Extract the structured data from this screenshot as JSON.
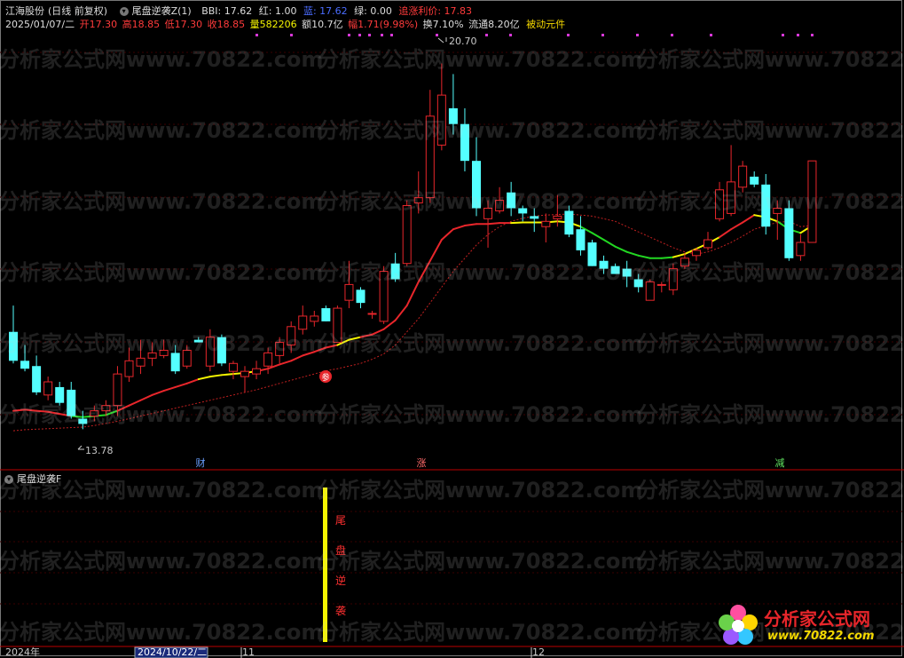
{
  "header": {
    "stock_name": "江海股份",
    "period": "(日线 前复权)",
    "indicator_name": "尾盘逆袭Z(1)",
    "bbi": "BBI: 17.62",
    "red": "红: 1.00",
    "blue": "蓝: 17.62",
    "green": "绿: 0.00",
    "pursue_label": "追涨利价: 17.83"
  },
  "quote": {
    "date": "2025/01/07/二",
    "open": "开17.30",
    "high": "高18.85",
    "low": "低17.30",
    "close": "收18.85",
    "volume": "量582206",
    "amount": "额10.7亿",
    "change": "幅1.71(9.98%)",
    "turnover": "换7.10%",
    "float": "流通8.20亿",
    "element": "被动元件"
  },
  "annotations": {
    "high_price": "20.70",
    "low_price": "13.78",
    "marker_cai": "财",
    "marker_zhang": "涨",
    "marker_jian": "减",
    "marker_can": "参"
  },
  "sub_panel": {
    "title": "尾盘逆袭F",
    "signal_text": [
      "尾",
      "盘",
      "逆",
      "袭"
    ]
  },
  "time_axis": {
    "labels": [
      "2024年",
      "2024/10/22/二",
      "11",
      "12"
    ]
  },
  "watermark": {
    "text": "分析家公式网www.70822.com"
  },
  "logo": {
    "title": "分析家公式网",
    "url": "www.70822.com"
  },
  "colors": {
    "up": "#e8262b",
    "down": "#54ffff",
    "line_up": "#e8262b",
    "line_green": "#22d722",
    "line_yellow": "#f5f500",
    "header_blue": "#4a6cff",
    "header_red": "#ff3b3b",
    "magenta": "#d838d8"
  },
  "chart_data": {
    "type": "candlestick",
    "y_range": [
      13.3,
      21.3
    ],
    "candles": [
      {
        "o": 15.6,
        "h": 16.1,
        "l": 15.0,
        "c": 15.05
      },
      {
        "o": 15.05,
        "h": 15.35,
        "l": 14.85,
        "c": 14.9
      },
      {
        "o": 14.95,
        "h": 15.15,
        "l": 14.4,
        "c": 14.45
      },
      {
        "o": 14.4,
        "h": 14.75,
        "l": 14.3,
        "c": 14.65
      },
      {
        "o": 14.55,
        "h": 14.65,
        "l": 14.2,
        "c": 14.25
      },
      {
        "o": 14.5,
        "h": 14.65,
        "l": 13.95,
        "c": 14.0
      },
      {
        "o": 13.95,
        "h": 14.1,
        "l": 13.75,
        "c": 13.85
      },
      {
        "o": 14.0,
        "h": 14.2,
        "l": 13.9,
        "c": 14.1
      },
      {
        "o": 14.1,
        "h": 14.3,
        "l": 14.0,
        "c": 14.2
      },
      {
        "o": 14.2,
        "h": 14.95,
        "l": 14.0,
        "c": 14.8
      },
      {
        "o": 14.75,
        "h": 15.3,
        "l": 14.65,
        "c": 15.05
      },
      {
        "o": 14.95,
        "h": 15.45,
        "l": 14.8,
        "c": 15.1
      },
      {
        "o": 15.1,
        "h": 15.4,
        "l": 14.95,
        "c": 15.2
      },
      {
        "o": 15.15,
        "h": 15.45,
        "l": 15.1,
        "c": 15.25
      },
      {
        "o": 15.2,
        "h": 15.35,
        "l": 14.8,
        "c": 14.85
      },
      {
        "o": 14.95,
        "h": 15.35,
        "l": 14.9,
        "c": 15.25
      },
      {
        "o": 15.45,
        "h": 15.5,
        "l": 15.4,
        "c": 15.4
      },
      {
        "o": 14.95,
        "h": 15.65,
        "l": 14.85,
        "c": 15.5
      },
      {
        "o": 15.5,
        "h": 15.55,
        "l": 14.95,
        "c": 15.0
      },
      {
        "o": 14.85,
        "h": 15.05,
        "l": 14.7,
        "c": 15.0
      },
      {
        "o": 14.75,
        "h": 14.95,
        "l": 14.45,
        "c": 14.85
      },
      {
        "o": 14.8,
        "h": 15.05,
        "l": 14.7,
        "c": 14.9
      },
      {
        "o": 14.95,
        "h": 15.3,
        "l": 14.8,
        "c": 15.2
      },
      {
        "o": 15.15,
        "h": 15.5,
        "l": 15.0,
        "c": 15.4
      },
      {
        "o": 15.35,
        "h": 15.8,
        "l": 15.2,
        "c": 15.7
      },
      {
        "o": 15.65,
        "h": 16.1,
        "l": 15.55,
        "c": 15.9
      },
      {
        "o": 15.8,
        "h": 16.0,
        "l": 15.7,
        "c": 15.9
      },
      {
        "o": 16.05,
        "h": 16.1,
        "l": 15.8,
        "c": 15.8
      },
      {
        "o": 15.4,
        "h": 16.1,
        "l": 15.4,
        "c": 16.05
      },
      {
        "o": 16.2,
        "h": 16.95,
        "l": 16.05,
        "c": 16.5
      },
      {
        "o": 16.4,
        "h": 16.45,
        "l": 16.05,
        "c": 16.15
      },
      {
        "o": 15.95,
        "h": 16.0,
        "l": 15.85,
        "c": 15.95
      },
      {
        "o": 15.8,
        "h": 16.85,
        "l": 15.75,
        "c": 16.75
      },
      {
        "o": 16.9,
        "h": 17.1,
        "l": 16.55,
        "c": 16.6
      },
      {
        "o": 16.9,
        "h": 18.1,
        "l": 16.85,
        "c": 18.0
      },
      {
        "o": 18.05,
        "h": 18.65,
        "l": 17.85,
        "c": 18.15
      },
      {
        "o": 18.15,
        "h": 20.2,
        "l": 18.05,
        "c": 19.7
      },
      {
        "o": 19.15,
        "h": 20.7,
        "l": 19.05,
        "c": 20.1
      },
      {
        "o": 19.85,
        "h": 20.5,
        "l": 19.35,
        "c": 19.55
      },
      {
        "o": 19.55,
        "h": 19.85,
        "l": 18.65,
        "c": 18.85
      },
      {
        "o": 18.85,
        "h": 19.3,
        "l": 17.8,
        "c": 17.95
      },
      {
        "o": 17.75,
        "h": 18.1,
        "l": 17.2,
        "c": 17.95
      },
      {
        "o": 17.9,
        "h": 18.35,
        "l": 17.85,
        "c": 18.1
      },
      {
        "o": 18.25,
        "h": 18.45,
        "l": 17.8,
        "c": 17.95
      },
      {
        "o": 17.95,
        "h": 18.0,
        "l": 17.7,
        "c": 17.85
      },
      {
        "o": 17.8,
        "h": 17.95,
        "l": 17.5,
        "c": 17.75
      },
      {
        "o": 17.6,
        "h": 17.85,
        "l": 17.3,
        "c": 17.7
      },
      {
        "o": 17.75,
        "h": 18.2,
        "l": 17.6,
        "c": 17.8
      },
      {
        "o": 17.9,
        "h": 18.0,
        "l": 17.4,
        "c": 17.45
      },
      {
        "o": 17.55,
        "h": 17.8,
        "l": 17.05,
        "c": 17.15
      },
      {
        "o": 17.3,
        "h": 17.35,
        "l": 16.85,
        "c": 16.85
      },
      {
        "o": 16.95,
        "h": 17.05,
        "l": 16.7,
        "c": 16.8
      },
      {
        "o": 16.85,
        "h": 16.9,
        "l": 16.7,
        "c": 16.7
      },
      {
        "o": 16.8,
        "h": 16.95,
        "l": 16.45,
        "c": 16.65
      },
      {
        "o": 16.6,
        "h": 16.7,
        "l": 16.35,
        "c": 16.45
      },
      {
        "o": 16.2,
        "h": 16.6,
        "l": 16.2,
        "c": 16.55
      },
      {
        "o": 16.5,
        "h": 16.55,
        "l": 16.35,
        "c": 16.5
      },
      {
        "o": 16.4,
        "h": 16.9,
        "l": 16.3,
        "c": 16.8
      },
      {
        "o": 16.85,
        "h": 17.1,
        "l": 16.8,
        "c": 17.0
      },
      {
        "o": 17.05,
        "h": 17.2,
        "l": 16.95,
        "c": 17.15
      },
      {
        "o": 17.2,
        "h": 17.5,
        "l": 17.15,
        "c": 17.35
      },
      {
        "o": 17.75,
        "h": 18.45,
        "l": 17.7,
        "c": 18.3
      },
      {
        "o": 17.85,
        "h": 19.15,
        "l": 17.8,
        "c": 18.45
      },
      {
        "o": 18.35,
        "h": 18.85,
        "l": 18.25,
        "c": 18.75
      },
      {
        "o": 18.55,
        "h": 18.65,
        "l": 18.35,
        "c": 18.4
      },
      {
        "o": 18.4,
        "h": 18.6,
        "l": 17.45,
        "c": 17.6
      },
      {
        "o": 17.85,
        "h": 18.1,
        "l": 17.35,
        "c": 17.95
      },
      {
        "o": 17.95,
        "h": 18.1,
        "l": 16.95,
        "c": 17.0
      },
      {
        "o": 17.05,
        "h": 17.45,
        "l": 16.95,
        "c": 17.3
      },
      {
        "o": 17.3,
        "h": 18.85,
        "l": 17.3,
        "c": 18.85
      }
    ],
    "ma_line": [
      14.1,
      14.12,
      14.1,
      14.08,
      14.04,
      14.0,
      13.98,
      14.0,
      14.02,
      14.1,
      14.2,
      14.3,
      14.4,
      14.48,
      14.55,
      14.62,
      14.7,
      14.75,
      14.78,
      14.8,
      14.82,
      14.85,
      14.9,
      14.98,
      15.05,
      15.15,
      15.22,
      15.3,
      15.35,
      15.45,
      15.5,
      15.55,
      15.65,
      15.82,
      16.1,
      16.55,
      16.95,
      17.35,
      17.55,
      17.62,
      17.65,
      17.65,
      17.67,
      17.67,
      17.68,
      17.68,
      17.68,
      17.7,
      17.68,
      17.6,
      17.48,
      17.35,
      17.22,
      17.12,
      17.05,
      17.0,
      17.0,
      17.02,
      17.08,
      17.18,
      17.28,
      17.4,
      17.55,
      17.68,
      17.82,
      17.78,
      17.7,
      17.55,
      17.48,
      17.62
    ],
    "ma_colors": [
      "r",
      "r",
      "r",
      "r",
      "r",
      "g",
      "g",
      "g",
      "g",
      "r",
      "r",
      "r",
      "r",
      "r",
      "r",
      "r",
      "y",
      "y",
      "y",
      "y",
      "y",
      "r",
      "r",
      "r",
      "r",
      "r",
      "r",
      "r",
      "y",
      "y",
      "r",
      "r",
      "r",
      "r",
      "r",
      "r",
      "r",
      "r",
      "r",
      "r",
      "r",
      "r",
      "r",
      "y",
      "y",
      "y",
      "y",
      "y",
      "y",
      "g",
      "g",
      "g",
      "g",
      "g",
      "g",
      "g",
      "g",
      "y",
      "y",
      "y",
      "y",
      "r",
      "r",
      "r",
      "y",
      "y",
      "g",
      "g",
      "y",
      "y"
    ],
    "dashed_line": [
      13.72,
      13.74,
      13.75,
      13.76,
      13.77,
      13.78,
      13.79,
      13.82,
      13.86,
      13.9,
      13.95,
      14.0,
      14.05,
      14.1,
      14.15,
      14.2,
      14.25,
      14.3,
      14.35,
      14.4,
      14.45,
      14.5,
      14.56,
      14.62,
      14.68,
      14.74,
      14.8,
      14.86,
      14.9,
      14.95,
      15.0,
      15.08,
      15.18,
      15.35,
      15.6,
      15.85,
      16.15,
      16.45,
      16.75,
      17.0,
      17.25,
      17.45,
      17.6,
      17.7,
      17.76,
      17.8,
      17.82,
      17.83,
      17.84,
      17.82,
      17.8,
      17.75,
      17.7,
      17.6,
      17.5,
      17.4,
      17.3,
      17.2,
      17.12,
      17.08,
      17.12,
      17.2,
      17.3,
      17.42,
      17.55,
      17.62,
      17.68,
      17.7,
      17.6,
      17.62
    ],
    "magenta_dots_x": [
      288,
      327,
      392,
      404,
      415,
      429,
      440,
      491,
      547,
      574,
      639,
      678,
      717,
      756,
      800,
      881,
      898,
      914
    ],
    "sub_signal_bar_x": 366
  }
}
